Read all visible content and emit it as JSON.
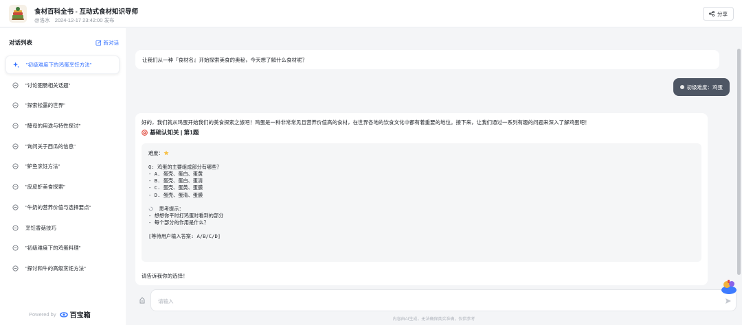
{
  "header": {
    "title": "食材百科全书 - 互动式食材知识导师",
    "author": "@洛水",
    "published": "2024-12-17 23:42:00 发布",
    "share_label": "分享"
  },
  "sidebar": {
    "title": "对话列表",
    "new_chat_label": "新对话",
    "items": [
      {
        "label": "\"初级难度下的鸡蛋烹饪方法\"",
        "active": true
      },
      {
        "label": "\"讨论肥肠相关话题\""
      },
      {
        "label": "\"探索松露的世界\""
      },
      {
        "label": "\"酵母的用途与特性探讨\""
      },
      {
        "label": "\"询问关于西瓜的信息\""
      },
      {
        "label": "\"鲈鱼烹饪方法\""
      },
      {
        "label": "\"皮皮虾美食探索\""
      },
      {
        "label": "\"牛奶的营养价值与选择要点\""
      },
      {
        "label": "烹饪香菇技巧"
      },
      {
        "label": "\"初级难度下的鸡蛋料理\""
      },
      {
        "label": "\"探讨和牛的高级烹饪方法\""
      }
    ],
    "powered_by": "Powered by",
    "brand": "百宝箱"
  },
  "chat": {
    "greeting": "让我们从一种『食材名』开始探索美食的奥秘，今天想了解什么食材呢？",
    "user_message": "初级难度：鸡蛋",
    "answer_intro": "好的，我们就从鸡蛋开始我们的美食探索之旅吧！鸡蛋是一种非常常见且营养价值高的食材，在世界各地的饮食文化中都有着重要的地位。接下来，让我们通过一系列有趣的问题来深入了解鸡蛋吧！",
    "question_heading": "基础认知关 | 第1题",
    "code_lines": [
      "难度：",
      "",
      "Q: 鸡蛋的主要组成部分有哪些？",
      "- A. 蛋壳、蛋白、蛋黄",
      "- B. 蛋壳、蛋白、蛋清",
      "- C. 蛋壳、蛋黄、蛋膜",
      "- D. 蛋壳、蛋清、蛋膜",
      "",
      "  思考提示：",
      "- 想想你平时打鸡蛋时看到的部分",
      "- 每个部分的作用是什么？",
      "",
      "[等待用户输入答案: A/B/C/D]"
    ],
    "closing": "请告诉我你的选择！"
  },
  "input": {
    "placeholder": "请输入"
  },
  "disclaimer": "内容由AI生成，无法确保真实准确，仅供参考",
  "colors": {
    "accent": "#3370ff",
    "user_bubble": "#4e5664",
    "background": "#f4f5f7"
  }
}
